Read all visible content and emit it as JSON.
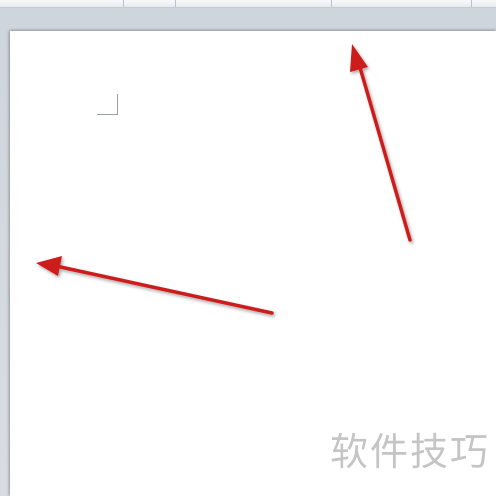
{
  "ribbon": {
    "labels": [
      "",
      "",
      ""
    ]
  },
  "page": {
    "cursor_marker": "text-area-corner"
  },
  "annotations": {
    "arrow_color": "#cc1c1c",
    "arrows": [
      "arrow-up",
      "arrow-left"
    ]
  },
  "watermark": {
    "text": "软件技巧"
  }
}
